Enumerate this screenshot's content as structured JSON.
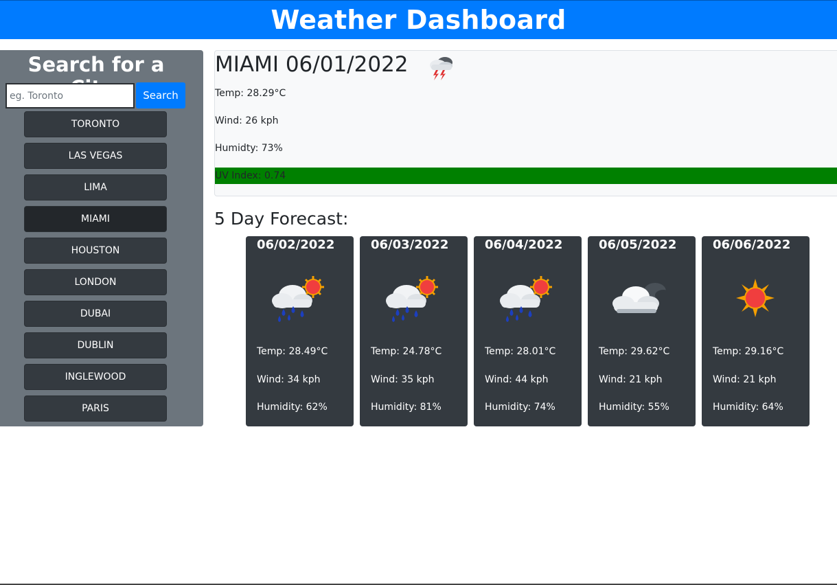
{
  "header": {
    "title": "Weather Dashboard"
  },
  "sidebar": {
    "heading": "Search for a City:",
    "search_placeholder": "eg. Toronto",
    "search_label": "Search",
    "cities": [
      {
        "label": "TORONTO"
      },
      {
        "label": "LAS VEGAS"
      },
      {
        "label": "LIMA"
      },
      {
        "label": "MIAMI",
        "active": true
      },
      {
        "label": "HOUSTON"
      },
      {
        "label": "LONDON"
      },
      {
        "label": "DUBAI"
      },
      {
        "label": "DUBLIN"
      },
      {
        "label": "INGLEWOOD"
      },
      {
        "label": "PARIS"
      }
    ]
  },
  "current": {
    "title": "MIAMI 06/01/2022",
    "icon": "thunderstorm-icon",
    "temp": "Temp: 28.29°C",
    "wind": "Wind: 26 kph",
    "humidity": "Humidty: 73%",
    "uv": "UV Index: 0.74",
    "uv_color": "#008000"
  },
  "forecast": {
    "title": "5 Day Forecast:",
    "days": [
      {
        "date": "06/02/2022",
        "icon": "rain-sun-icon",
        "temp": "Temp: 28.49°C",
        "wind": "Wind: 34 kph",
        "humidity": "Humidity: 62%"
      },
      {
        "date": "06/03/2022",
        "icon": "rain-sun-icon",
        "temp": "Temp: 24.78°C",
        "wind": "Wind: 35 kph",
        "humidity": "Humidity: 81%"
      },
      {
        "date": "06/04/2022",
        "icon": "rain-sun-icon",
        "temp": "Temp: 28.01°C",
        "wind": "Wind: 44 kph",
        "humidity": "Humidity: 74%"
      },
      {
        "date": "06/05/2022",
        "icon": "cloudy-icon",
        "temp": "Temp: 29.62°C",
        "wind": "Wind: 21 kph",
        "humidity": "Humidity: 55%"
      },
      {
        "date": "06/06/2022",
        "icon": "sun-icon",
        "temp": "Temp: 29.16°C",
        "wind": "Wind: 21 kph",
        "humidity": "Humidity: 64%"
      }
    ]
  },
  "colors": {
    "header": "#007bff",
    "sidebar": "#6c757d",
    "card": "#343a40",
    "uv_good": "#008000"
  }
}
